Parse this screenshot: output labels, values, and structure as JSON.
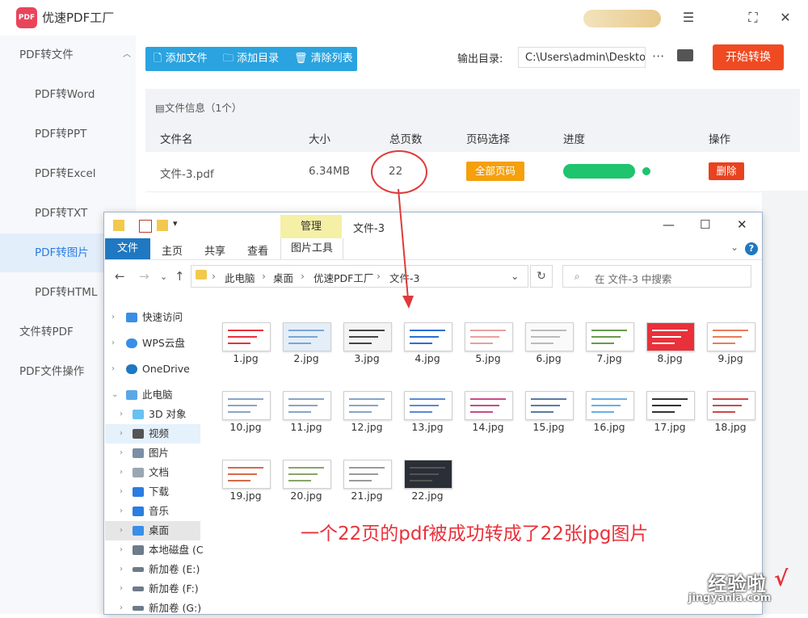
{
  "app": {
    "title": "优速PDF工厂",
    "logo_text": "PDF"
  },
  "sidebar": {
    "groups": [
      {
        "label": "PDF转文件",
        "caret": "^"
      },
      {
        "label": "文件转PDF",
        "caret": "v"
      },
      {
        "label": "PDF文件操作",
        "caret": "v"
      }
    ],
    "items": [
      {
        "label": "PDF转Word"
      },
      {
        "label": "PDF转PPT"
      },
      {
        "label": "PDF转Excel"
      },
      {
        "label": "PDF转TXT"
      },
      {
        "label": "PDF转图片"
      },
      {
        "label": "PDF转HTML"
      }
    ]
  },
  "toolbar": {
    "add_file": "添加文件",
    "add_dir": "添加目录",
    "clear_list": "清除列表",
    "output_label": "输出目录:",
    "output_path": "C:\\Users\\admin\\Desktop",
    "more": "···",
    "start": "开始转换"
  },
  "filelist": {
    "info": "文件信息（1个）",
    "headers": {
      "name": "文件名",
      "size": "大小",
      "pages": "总页数",
      "page_select": "页码选择",
      "progress": "进度",
      "actions": "操作"
    },
    "row": {
      "name": "文件-3.pdf",
      "size": "6.34MB",
      "pages": "22",
      "page_select": "全部页码",
      "progress": 1.0,
      "delete": "删除"
    }
  },
  "explorer": {
    "context_tab": "管理",
    "window_title": "文件-3",
    "ribbon": {
      "file": "文件",
      "home": "主页",
      "share": "共享",
      "view": "查看",
      "pic_tools": "图片工具"
    },
    "breadcrumb": [
      "此电脑",
      "桌面",
      "优速PDF工厂",
      "文件-3"
    ],
    "search_placeholder": "在 文件-3 中搜索",
    "nav": [
      {
        "label": "快速访问"
      },
      {
        "label": "WPS云盘"
      },
      {
        "label": "OneDrive"
      },
      {
        "label": "此电脑"
      },
      {
        "label": "3D 对象"
      },
      {
        "label": "视频"
      },
      {
        "label": "图片"
      },
      {
        "label": "文档"
      },
      {
        "label": "下载"
      },
      {
        "label": "音乐"
      },
      {
        "label": "桌面"
      },
      {
        "label": "本地磁盘 (C"
      },
      {
        "label": "新加卷 (E:)"
      },
      {
        "label": "新加卷 (F:)"
      },
      {
        "label": "新加卷 (G:)"
      }
    ],
    "files": [
      "1.jpg",
      "2.jpg",
      "3.jpg",
      "4.jpg",
      "5.jpg",
      "6.jpg",
      "7.jpg",
      "8.jpg",
      "9.jpg",
      "10.jpg",
      "11.jpg",
      "12.jpg",
      "13.jpg",
      "14.jpg",
      "15.jpg",
      "16.jpg",
      "17.jpg",
      "18.jpg",
      "19.jpg",
      "20.jpg",
      "21.jpg",
      "22.jpg"
    ]
  },
  "annotation": {
    "caption": "一个22页的pdf被成功转成了22张jpg图片"
  },
  "watermark": {
    "line1": "经验啦",
    "line2": "jingyanla.com",
    "check": "√"
  },
  "colors": {
    "accent_blue": "#2aa3e0",
    "start_red": "#f04a22",
    "page_orange": "#f5a00c",
    "progress_green": "#1ec46e",
    "delete_red": "#e8421f",
    "annotation_red": "#e8313a"
  }
}
